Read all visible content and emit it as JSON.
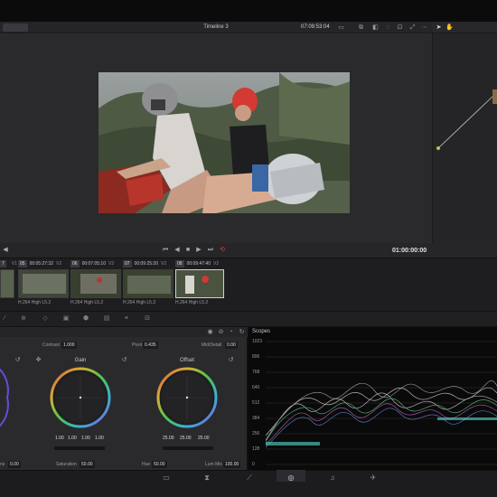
{
  "viewer": {
    "timeline_name": "Timeline 3",
    "timecode": "07:09:53:04",
    "end_timecode": "01:00:00:00"
  },
  "clips": [
    {
      "num": "7",
      "track": "V1",
      "timecode": "",
      "codec": ""
    },
    {
      "num": "05",
      "track": "V2",
      "timecode": "00:05:27:32",
      "codec": "H.264 High L5.2"
    },
    {
      "num": "06",
      "track": "V2",
      "timecode": "00:07:05:10",
      "codec": "H.264 High L5.2"
    },
    {
      "num": "07",
      "track": "V2",
      "timecode": "00:09:25:20",
      "codec": "H.264 High L5.2"
    },
    {
      "num": "08",
      "track": "V2",
      "timecode": "00:09:47:40",
      "codec": "H.264 High L5.2"
    }
  ],
  "primaries": {
    "contrast_label": "Contrast",
    "contrast_value": "1.000",
    "pivot_label": "Pivot",
    "pivot_value": "0.435",
    "middetail_label": "Mid/Detail",
    "middetail_value": "0.00",
    "gain_title": "Gain",
    "gain_values": [
      "1.00",
      "1.00",
      "1.00",
      "1.00"
    ],
    "offset_title": "Offset",
    "offset_values": [
      "25.00",
      "25.00",
      "25.00"
    ],
    "col_boost_label": "ns",
    "col_boost_value": "0.00",
    "saturation_label": "Saturation",
    "saturation_value": "50.00",
    "hue_label": "Hue",
    "hue_value": "50.00",
    "lum_mix_label": "Lum Mix",
    "lum_mix_value": "100.00"
  },
  "scopes": {
    "title": "Scopes",
    "ticks": [
      "1023",
      "896",
      "768",
      "640",
      "512",
      "384",
      "256",
      "128",
      "0"
    ]
  },
  "icons": {
    "transport": [
      "skip-back-icon",
      "step-back-icon",
      "stop-icon",
      "play-icon",
      "skip-forward-icon",
      "loop-icon"
    ],
    "pages": [
      "cut-icon",
      "edit-icon",
      "fusion-icon",
      "color-icon",
      "fairlight-icon",
      "deliver-icon"
    ]
  },
  "colors": {
    "accent_red": "#e0403a",
    "scope_bg": "#0a0a0b",
    "panel_bg": "#2a2a2c"
  }
}
